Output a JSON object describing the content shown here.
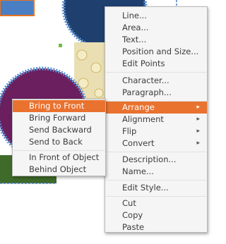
{
  "main_menu": {
    "items": [
      {
        "label": "Line...",
        "submenu": false
      },
      {
        "label": "Area...",
        "submenu": false
      },
      {
        "label": "Text...",
        "submenu": false
      },
      {
        "label": "Position and Size...",
        "submenu": false
      },
      {
        "label": "Edit Points",
        "submenu": false
      },
      {
        "label": "Character...",
        "submenu": false
      },
      {
        "label": "Paragraph...",
        "submenu": false
      },
      {
        "label": "Arrange",
        "submenu": true
      },
      {
        "label": "Alignment",
        "submenu": true
      },
      {
        "label": "Flip",
        "submenu": true
      },
      {
        "label": "Convert",
        "submenu": true
      },
      {
        "label": "Description...",
        "submenu": false
      },
      {
        "label": "Name...",
        "submenu": false
      },
      {
        "label": "Edit Style...",
        "submenu": false
      },
      {
        "label": "Cut",
        "submenu": false
      },
      {
        "label": "Copy",
        "submenu": false
      },
      {
        "label": "Paste",
        "submenu": false
      }
    ],
    "submenu_arrow": "▸"
  },
  "arrange_submenu": {
    "items": [
      {
        "label": "Bring to Front"
      },
      {
        "label": "Bring Forward"
      },
      {
        "label": "Send Backward"
      },
      {
        "label": "Send to Back"
      },
      {
        "label": "In Front of Object"
      },
      {
        "label": "Behind Object"
      }
    ]
  },
  "colors": {
    "highlight": "#e9722f",
    "circle_fill": "#1f3f6e",
    "circle_border": "#5b93d6",
    "purple_fill": "#6b1f5f",
    "green_fill": "#3f6b2a",
    "orange_frame": "#e8731f",
    "blue_rect": "#4a7fc4"
  }
}
